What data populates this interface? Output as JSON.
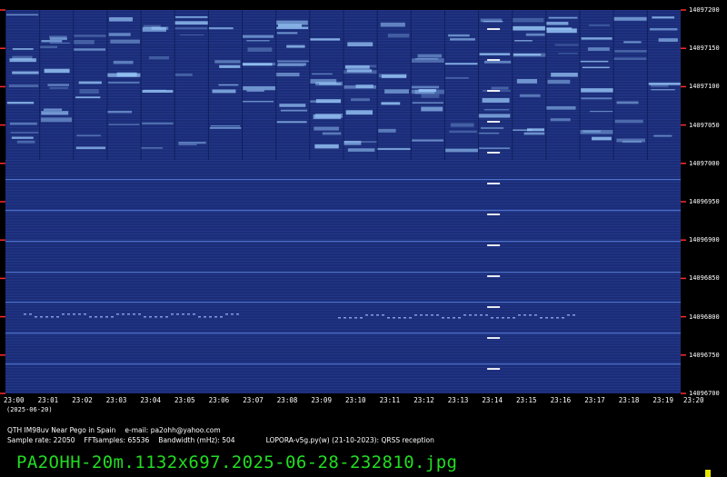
{
  "colors": {
    "background": "#000000",
    "waterfall_base": "#1b2d78",
    "signal": "#9fd0ff",
    "tick_red": "#ff2a2a",
    "filename_text": "#22dd22",
    "marker_yellow": "#e6e600"
  },
  "frequency_axis": {
    "labels": [
      "14097200",
      "14097150",
      "14097100",
      "14097050",
      "14097000",
      "14096950",
      "14096900",
      "14096850",
      "14096800",
      "14096750",
      "14096700"
    ]
  },
  "time_axis": {
    "labels": [
      "23:00",
      "23:01",
      "23:02",
      "23:03",
      "23:04",
      "23:05",
      "23:06",
      "23:07",
      "23:08",
      "23:09",
      "23:10",
      "23:11",
      "23:12",
      "23:13",
      "23:14",
      "23:15",
      "23:16",
      "23:17",
      "23:18",
      "23:19",
      "23:20"
    ],
    "date": "(2025-06-20)"
  },
  "info": {
    "line1": {
      "qth": "QTH IM98uv Near Pego in Spain",
      "email": "e-mail: pa2ohh@yahoo.com"
    },
    "line2": {
      "sample_rate": "Sample rate: 22050",
      "fft_samples": "FFTsamples: 65536",
      "bandwidth": "Bandwidth (mHz): 504",
      "software": "LOPORA-v5g.py(w) (21-10-2023): QRSS reception"
    }
  },
  "filename": "PA2OHH-20m.1132x697.2025-06-28-232810.jpg"
}
